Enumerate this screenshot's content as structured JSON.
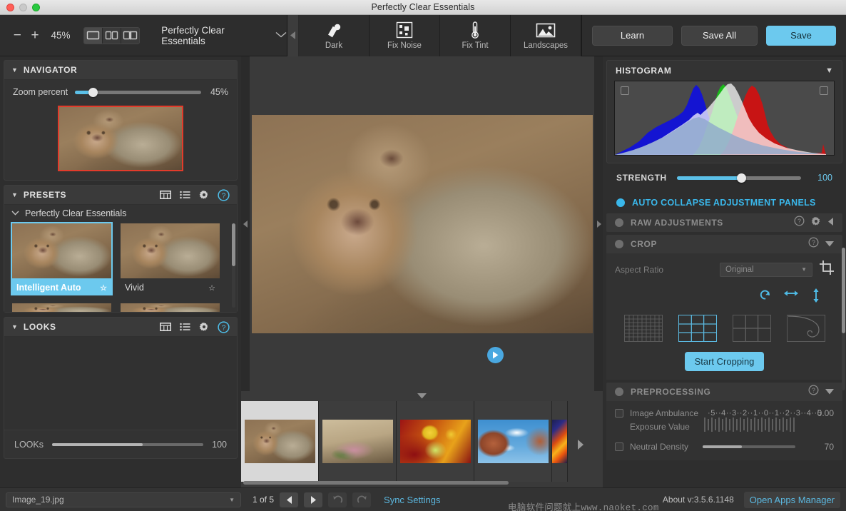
{
  "window": {
    "title": "Perfectly Clear Essentials"
  },
  "toolbar": {
    "zoom_out": "−",
    "zoom_in": "+",
    "zoom_percent": "45%",
    "view_modes": [
      "single-view",
      "split-view",
      "compare-view"
    ],
    "preset_menu_label": "Perfectly Clear Essentials",
    "tools": [
      {
        "label": "Dark",
        "icon": "dark-icon"
      },
      {
        "label": "Fix Noise",
        "icon": "fix-noise-icon"
      },
      {
        "label": "Fix Tint",
        "icon": "fix-tint-icon"
      },
      {
        "label": "Landscapes",
        "icon": "landscapes-icon"
      }
    ],
    "learn_label": "Learn",
    "save_all_label": "Save All",
    "save_label": "Save"
  },
  "navigator": {
    "title": "NAVIGATOR",
    "zoom_label": "Zoom percent",
    "zoom_value": "45%",
    "zoom_fill_pct": 14
  },
  "presets": {
    "title": "PRESETS",
    "group_label": "Perfectly Clear Essentials",
    "items": [
      {
        "label": "Intelligent Auto",
        "selected": true,
        "star": "☆"
      },
      {
        "label": "Vivid",
        "selected": false,
        "star": "☆"
      }
    ]
  },
  "looks": {
    "title": "LOOKS",
    "slider_label": "LOOKs",
    "slider_value": "100",
    "slider_fill_pct": 60
  },
  "histogram": {
    "title": "HISTOGRAM",
    "strength_label": "STRENGTH",
    "strength_value": "100",
    "strength_fill_pct": 52
  },
  "adjustments": {
    "auto_collapse_label": "AUTO COLLAPSE ADJUSTMENT PANELS",
    "raw_adjustments_label": "RAW ADJUSTMENTS",
    "crop_label": "CROP",
    "aspect_ratio_label": "Aspect Ratio",
    "aspect_ratio_value": "Original",
    "start_cropping_label": "Start Cropping",
    "grid_options": [
      "fine-grid",
      "thirds-grid",
      "quad-grid",
      "golden-spiral"
    ],
    "grid_selected_index": 1,
    "preprocessing_label": "PREPROCESSING",
    "image_ambulance_label": "Image Ambulance",
    "exposure_value_label": "Exposure Value",
    "exposure_scale": "·5··4··3··2··1··0··1··2··3··4··5",
    "exposure_number": "0.00",
    "neutral_density_label": "Neutral Density",
    "neutral_density_value": "70",
    "neutral_density_fill_pct": 42
  },
  "filmstrip": {
    "items": [
      {
        "name": "monkeys-thumb",
        "selected": true
      },
      {
        "name": "leaf-thumb",
        "selected": false
      },
      {
        "name": "ladybug-thumb",
        "selected": false
      },
      {
        "name": "canyon-sky-thumb",
        "selected": false
      },
      {
        "name": "abstract-thumb",
        "selected": false
      }
    ]
  },
  "status": {
    "filename": "Image_19.jpg",
    "page_of": "1 of 5",
    "sync_settings_label": "Sync Settings",
    "about_label": "About v:3.5.6.1148",
    "open_apps_manager_label": "Open Apps Manager",
    "watermark": "电脑软件问题就上www.naoket.com"
  },
  "chart_data": {
    "type": "area",
    "title": "HISTOGRAM",
    "xlabel": "",
    "ylabel": "",
    "series": [
      {
        "name": "blue",
        "color": "#1414d2",
        "peak_x": 0.38,
        "peak_y": 0.96
      },
      {
        "name": "green",
        "color": "#19bb19",
        "peak_x": 0.5,
        "peak_y": 0.98
      },
      {
        "name": "red",
        "color": "#c81414",
        "peak_x": 0.62,
        "peak_y": 0.94
      },
      {
        "name": "luminance",
        "color": "#d8d8d8",
        "peak_x": 0.53,
        "peak_y": 1.0
      }
    ],
    "xlim": [
      0,
      255
    ],
    "ylim": [
      0,
      1
    ],
    "grid": false,
    "legend": "none"
  }
}
